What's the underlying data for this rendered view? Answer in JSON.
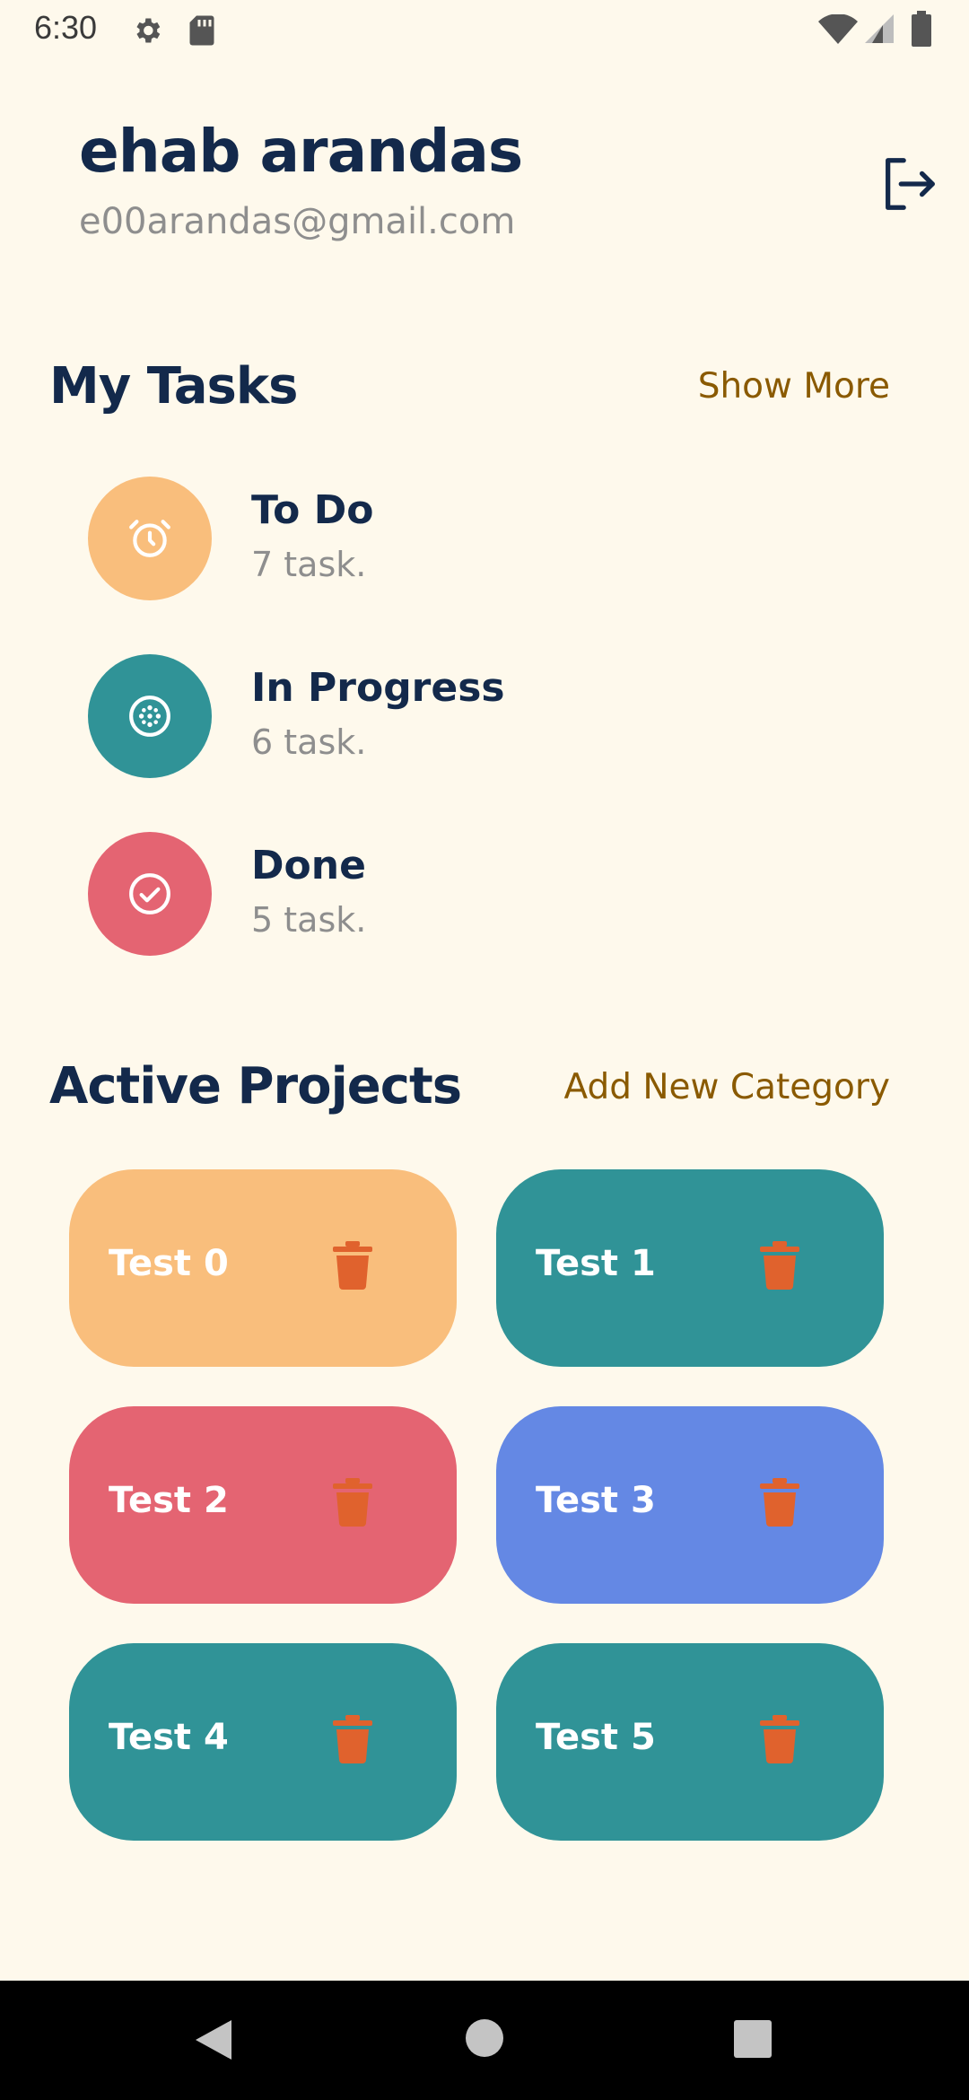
{
  "status_bar": {
    "time": "6:30",
    "icons": [
      "settings-icon",
      "sd-card-icon",
      "wifi-icon",
      "signal-icon",
      "battery-icon"
    ]
  },
  "user": {
    "name": "ehab arandas",
    "email": "e00arandas@gmail.com"
  },
  "logout_icon": "logout-icon",
  "my_tasks": {
    "title": "My Tasks",
    "link": "Show More",
    "items": [
      {
        "label": "To Do",
        "count": "7 task.",
        "color": "#F9BE7C",
        "icon": "alarm-clock-icon"
      },
      {
        "label": "In Progress",
        "count": "6 task.",
        "color": "#309397",
        "icon": "loader-icon"
      },
      {
        "label": "Done",
        "count": "5 task.",
        "color": "#E46472",
        "icon": "check-circle-icon"
      }
    ]
  },
  "active_projects": {
    "title": "Active Projects",
    "link": "Add New Category",
    "items": [
      {
        "name": "Test 0",
        "color": "#F9BE7C"
      },
      {
        "name": "Test 1",
        "color": "#309397"
      },
      {
        "name": "Test 2",
        "color": "#E46472"
      },
      {
        "name": "Test 3",
        "color": "#6488E4"
      },
      {
        "name": "Test 4",
        "color": "#309397"
      },
      {
        "name": "Test 5",
        "color": "#309397"
      }
    ]
  },
  "colors": {
    "background": "#FEF9EC",
    "heading": "#13294B",
    "muted": "#8E8E8E",
    "link": "#8A5A00",
    "delete_icon": "#E0622D"
  }
}
